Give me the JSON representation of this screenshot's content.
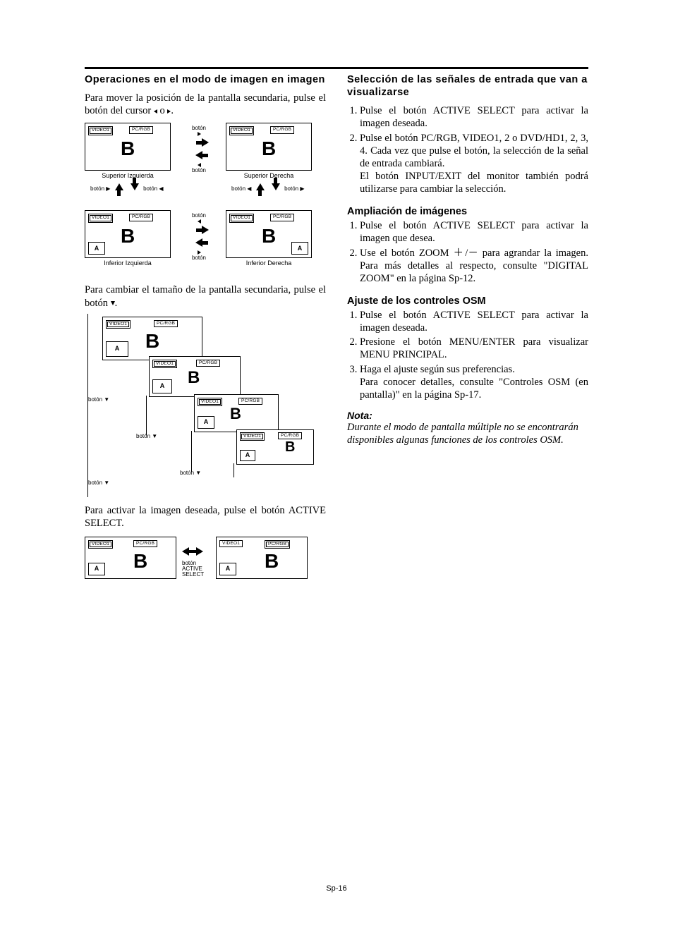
{
  "left": {
    "title": "Operaciones en el modo de imagen en imagen",
    "p1_a": "Para mover la posición de la pantalla secundaria, pulse el botón del cursor ",
    "p1_b": " o ",
    "p1_c": ".",
    "diag1": {
      "supIzq": "Superior Izquierda",
      "supDer": "Superior Derecha",
      "infIzq": "Inferior Izquierda",
      "infDer": "Inferior Derecha",
      "video": "VIDEO1",
      "pcrgb": "PC/RGB",
      "b": "B",
      "a": "A",
      "boton": "botón",
      "botonR": "botón ▶",
      "botonL": "botón ◀"
    },
    "p2_a": "Para cambiar el tamaño de la pantalla secundaria, pulse el botón ",
    "p2_b": ".",
    "diag2": {
      "video": "VIDEO1",
      "pcrgb": "PC/RGB",
      "b": "B",
      "a": "A",
      "botonDown": "botón ▼"
    },
    "p3": "Para activar la imagen deseada, pulse el botón ACTIVE SELECT.",
    "diag3": {
      "video": "VIDEO1",
      "pcrgb": "PC/RGB",
      "b": "B",
      "a": "A",
      "label": "botón\nACTIVE\nSELECT"
    }
  },
  "right": {
    "sec1_title": "Selección de las señales de entrada que van a visualizarse",
    "sec1_items": [
      "Pulse el botón ACTIVE SELECT para activar la imagen deseada.",
      "Pulse el botón PC/RGB, VIDEO1, 2 o DVD/HD1, 2, 3, 4. Cada vez que pulse el botón, la selección de la señal de entrada cambiará.\nEl botón INPUT/EXIT del monitor también podrá utilizarse para cambiar la selección."
    ],
    "sec2_title": "Ampliación de imágenes",
    "sec2_items": [
      "Pulse el botón ACTIVE SELECT para activar la imagen que desea.",
      "Use el botón ZOOM ＋/－ para agrandar la imagen. Para más detalles al respecto, consulte \"DIGITAL ZOOM\" en la página Sp-12."
    ],
    "sec3_title": "Ajuste de los controles OSM",
    "sec3_items": [
      "Pulse el botón ACTIVE SELECT para activar la imagen deseada.",
      "Presione el botón MENU/ENTER para visualizar MENU PRINCIPAL.",
      "Haga el ajuste según sus preferencias.\nPara conocer detalles, consulte \"Controles OSM (en pantalla)\" en la página Sp-17."
    ],
    "nota_label": "Nota:",
    "nota_text": "Durante el modo de pantalla múltiple no se encontrarán disponibles algunas funciones de los controles OSM."
  },
  "footer": "Sp-16"
}
